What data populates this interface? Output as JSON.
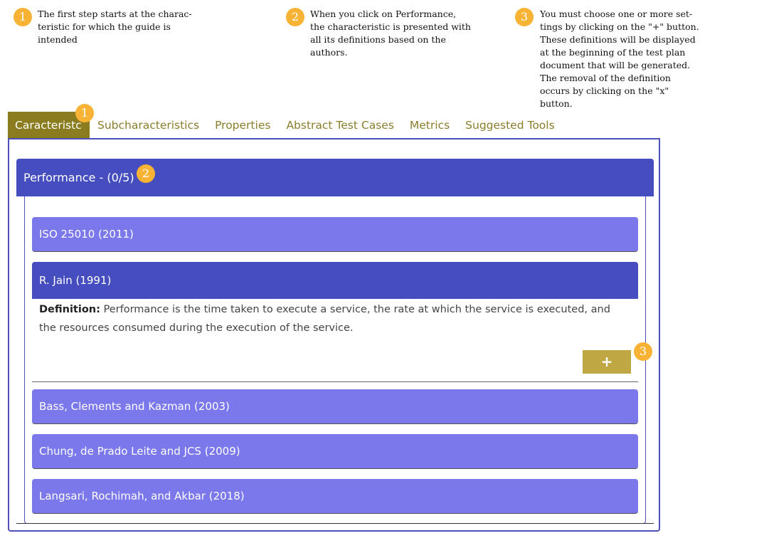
{
  "notes": [
    {
      "number": "1",
      "text": "The first step starts at the charac-\nteristic for which the guide is\nintended"
    },
    {
      "number": "2",
      "text": "When you click on Performance,\nthe characteristic is presented with\nall its definitions based on the\nauthors."
    },
    {
      "number": "3",
      "text": "You must choose one or more set-\ntings by clicking on the \"+\" button.\nThese definitions will be displayed\nat the beginning of the test plan\ndocument that will be generated.\nThe removal of the definition\noccurs by clicking on the \"x\"\nbutton."
    }
  ],
  "tabs": [
    "Caracteristc",
    "Subcharacteristics",
    "Properties",
    "Abstract Test Cases",
    "Metrics",
    "Suggested Tools"
  ],
  "markers": {
    "tab": "1",
    "performance": "2",
    "add": "3"
  },
  "performance": {
    "label": "Performance - (0/5)"
  },
  "definitions": [
    {
      "label": "ISO 25010 (2011)"
    },
    {
      "label": "R. Jain (1991)"
    },
    {
      "label": "Bass, Clements and Kazman (2003)"
    },
    {
      "label": "Chung, de Prado Leite and JCS (2009)"
    },
    {
      "label": "Langsari, Rochimah, and Akbar (2018)"
    }
  ],
  "open_definition": {
    "prefix": "Definition:",
    "text": " Performance is the time taken to execute a service, the rate at which the service is executed, and the resources consumed during the execution of the service."
  },
  "add_button": {
    "label": "+"
  },
  "colors": {
    "accent": "#8b7d1f",
    "header": "#454dbf",
    "item": "#7b78ec",
    "badge": "#f8b234",
    "button": "#bfa843"
  }
}
